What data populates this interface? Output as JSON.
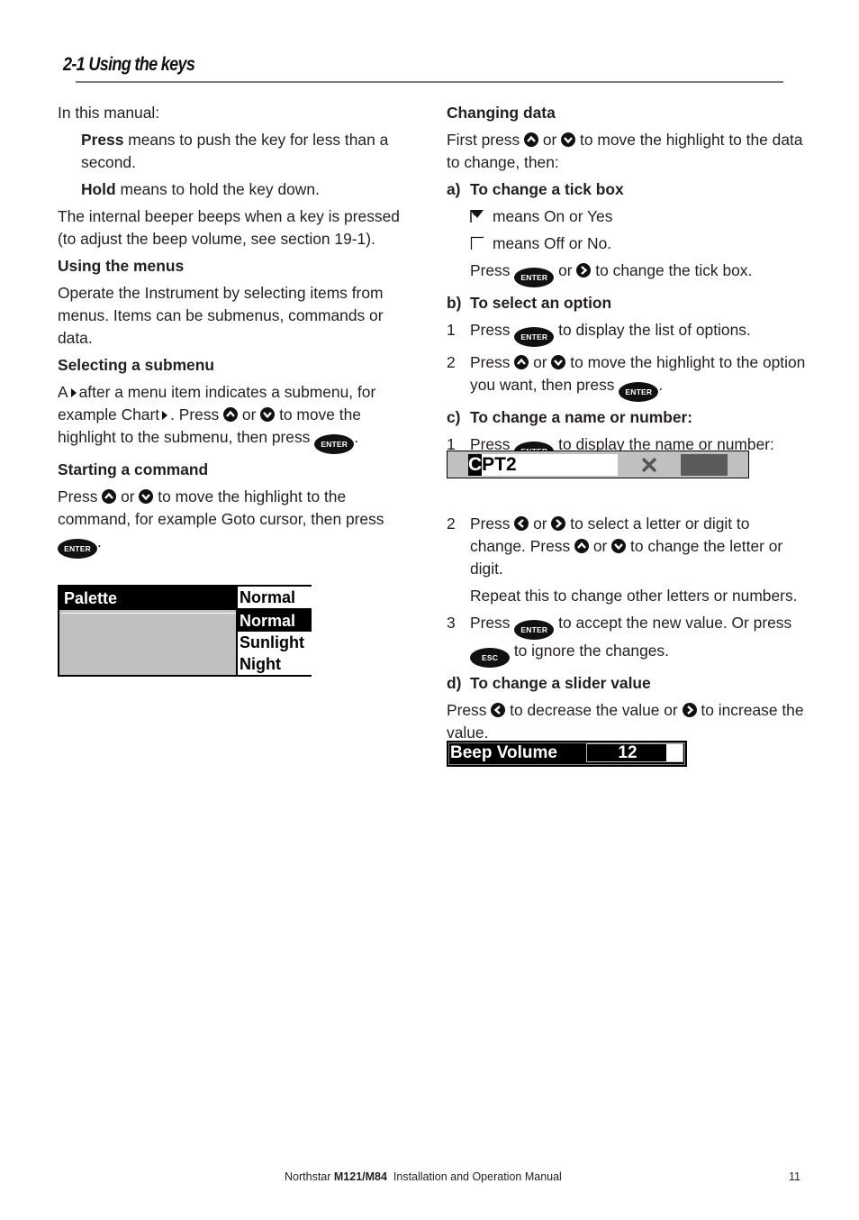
{
  "section_title": "2-1 Using the keys",
  "left": {
    "intro": "In this manual:",
    "press_term": "Press",
    "press_def": " means to push the key for less than a second.",
    "hold_term": "Hold",
    "hold_def": " means to hold the key down.",
    "beeper": "The internal beeper beeps when a key is pressed (to adjust the beep volume, see section 19-1).",
    "menus_heading": "Using the menus",
    "menus_text": "Operate the Instrument by selecting items from menus. Items can be submenus, commands or data.",
    "submenu_heading": "Selecting a submenu",
    "submenu_t1": "A",
    "submenu_t2": "after a menu item indicates a submenu, for example Chart",
    "submenu_t3": ".  Press",
    "submenu_t4": "or",
    "submenu_t5": "to move the highlight to the submenu, then press",
    "submenu_t6": ".",
    "command_heading": "Starting a command",
    "command_t1": "Press",
    "command_t2": "or",
    "command_t3": "to move the highlight to the command, for example Goto cursor, then press",
    "command_t4": "."
  },
  "palette_widget": {
    "label": "Palette",
    "current_value": "Normal",
    "options": [
      {
        "label": "Normal",
        "selected": true
      },
      {
        "label": "Sunlight",
        "selected": false
      },
      {
        "label": "Night",
        "selected": false
      }
    ]
  },
  "right": {
    "changing_heading": "Changing data",
    "changing_t1": "First press",
    "changing_t2": "or",
    "changing_t3": "to move the highlight to the data to change, then:",
    "a_letter": "a)",
    "a_heading": "To change a tick box",
    "tick_on": "means On or Yes",
    "tick_off": "means Off or No.",
    "tick_press1": "Press",
    "tick_press2": "or",
    "tick_press3": "to change the tick box.",
    "b_letter": "b)",
    "b_heading": "To select an option",
    "b1_n": "1",
    "b1_t1": "Press",
    "b1_t2": "to display the list of options.",
    "b2_n": "2",
    "b2_t1": "Press",
    "b2_t2": "or",
    "b2_t3": "to move the highlight to the option you want, then press",
    "b2_t4": ".",
    "c_letter": "c)",
    "c_heading": "To change a name or number:",
    "c1_n": "1",
    "c1_t1": "Press",
    "c1_t2": "to display the name or number:",
    "c2_n": "2",
    "c2_t1": "Press",
    "c2_t2": "or",
    "c2_t3": "to select a letter or digit to change. Press",
    "c2_t4": "or",
    "c2_t5": "to change the letter or digit.",
    "c_repeat": "Repeat this to change other letters or numbers.",
    "c3_n": "3",
    "c3_t1": "Press",
    "c3_t2": "to accept the new value. Or press",
    "c3_t3": "to ignore the changes.",
    "d_letter": "d)",
    "d_heading": "To change a slider value",
    "d_t1": "Press",
    "d_t2": "to decrease the value or",
    "d_t3": "to increase the value."
  },
  "name_widget": {
    "cursor_char": "C",
    "rest": "PT2"
  },
  "slider_widget": {
    "label": "Beep Volume",
    "value": "12",
    "fill_fraction": 0.83
  },
  "keys": {
    "enter": "ENTER",
    "esc": "ESC"
  },
  "footer": {
    "brand": "Northstar ",
    "model": "M121/M84",
    "manual": "  Installation and Operation Manual",
    "page": "11"
  }
}
